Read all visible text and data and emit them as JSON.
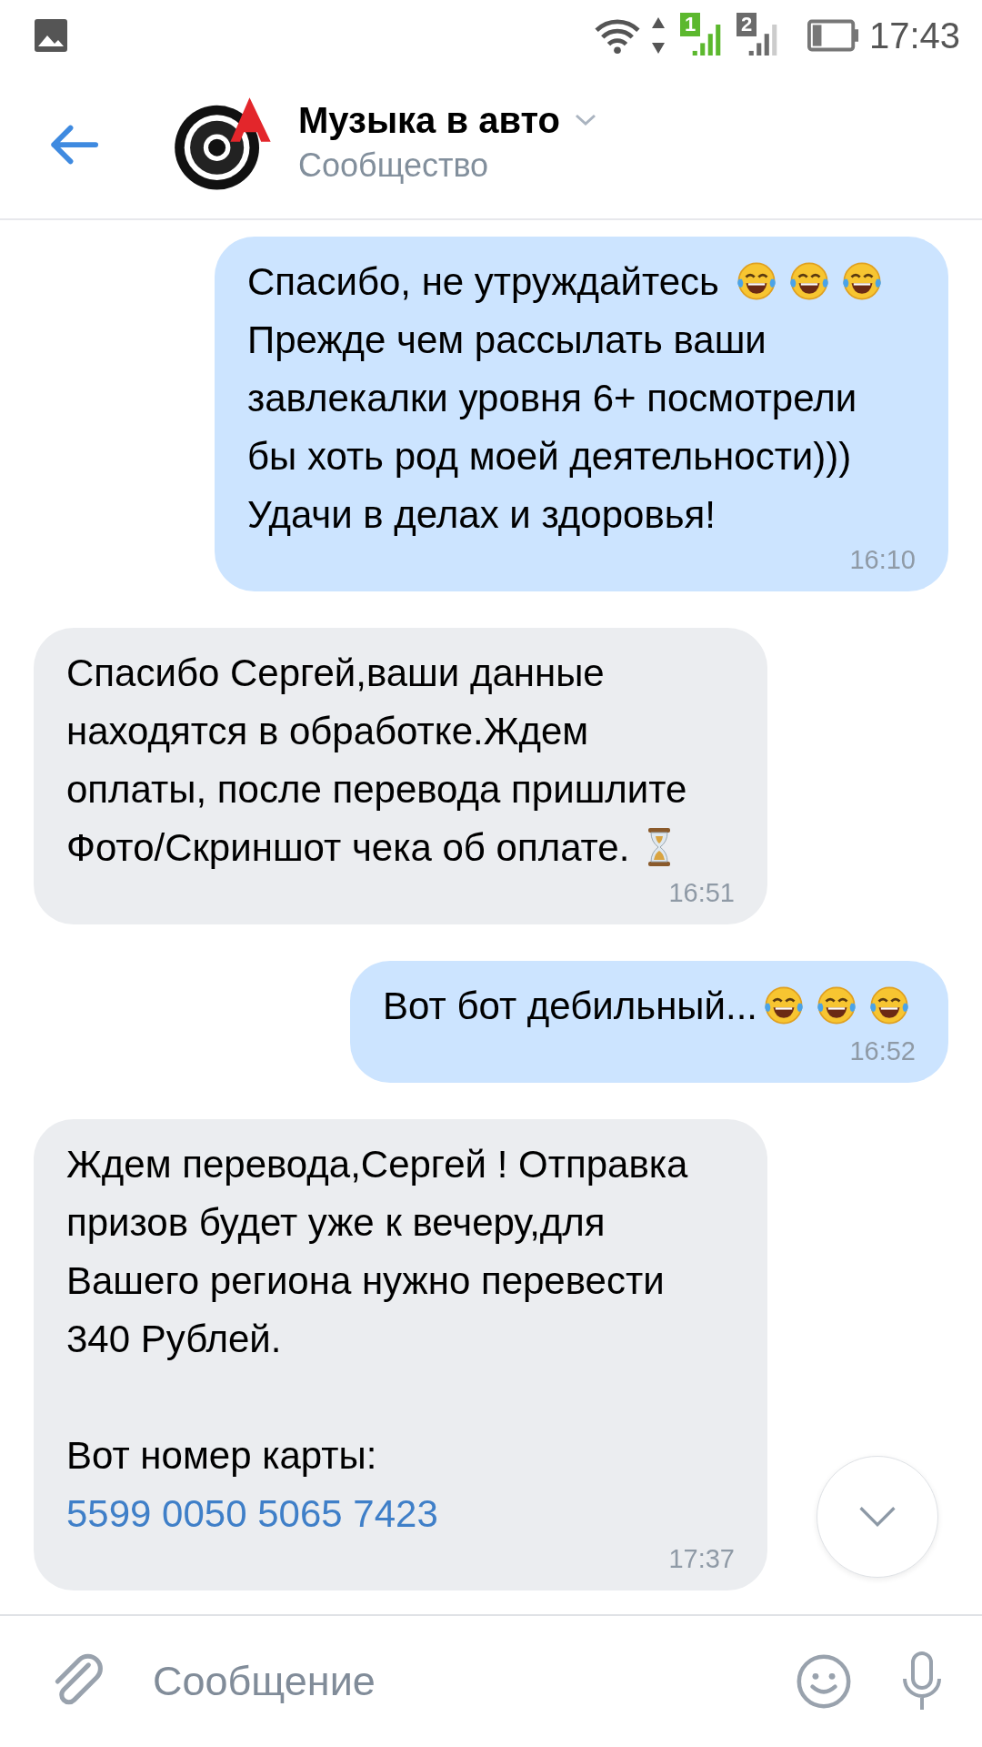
{
  "status_bar": {
    "time": "17:43",
    "sims": [
      {
        "label": "1",
        "color": "#5cb82e"
      },
      {
        "label": "2",
        "color": "#6b6b6b"
      }
    ]
  },
  "header": {
    "title": "Музыка в авто",
    "subtitle": "Сообщество"
  },
  "messages": [
    {
      "kind": "outgoing",
      "time": "16:10",
      "parts": [
        {
          "kind": "text",
          "text": "Спасибо, не утруждайтесь "
        },
        {
          "kind": "laugh"
        },
        {
          "kind": "laugh"
        },
        {
          "kind": "laugh"
        },
        {
          "kind": "text",
          "text": " Прежде чем рассылать ваши завлекалки уровня 6+ посмотрели бы хоть род моей деятельности))) Удачи в делах и здоровья!"
        }
      ]
    },
    {
      "kind": "incoming",
      "time": "16:51",
      "parts": [
        {
          "kind": "text",
          "text": "Спасибо Сергей,ваши данные находятся в обработке.Ждем оплаты, после перевода пришлите Фото/Скриншот чека об оплате. "
        },
        {
          "kind": "hourglass"
        }
      ]
    },
    {
      "kind": "outgoing",
      "time": "16:52",
      "parts": [
        {
          "kind": "text",
          "text": "Вот бот дебильный..."
        },
        {
          "kind": "laugh"
        },
        {
          "kind": "laugh"
        },
        {
          "kind": "laugh"
        }
      ]
    },
    {
      "kind": "incoming",
      "time": "17:37",
      "parts": [
        {
          "kind": "text",
          "text": "Ждем перевода,Сергей ! Отправка призов будет уже к вечеру,для Вашего региона нужно перевести 340 Рублей.\n\nВот номер карты: "
        },
        {
          "kind": "link",
          "text": "5599 0050 5065 7423"
        }
      ]
    }
  ],
  "composer": {
    "placeholder": "Сообщение"
  }
}
